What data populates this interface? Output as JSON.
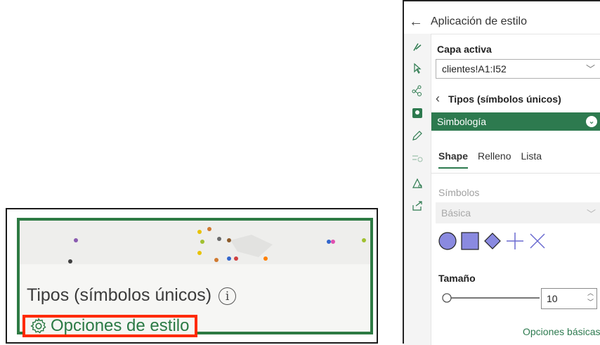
{
  "thumbnail": {
    "title": "Tipos (símbolos únicos)",
    "info_icon": "info-icon",
    "options_link": "Opciones de estilo",
    "options_icon": "gear-icon"
  },
  "panel": {
    "header_title": "Aplicación de estilo",
    "back_icon": "arrow-left-icon",
    "rail_icons": [
      "brush-icon",
      "cursor-icon",
      "network-icon",
      "layer-icon",
      "pencil-icon",
      "filter-icon",
      "map-pin-icon",
      "share-icon"
    ],
    "active_layer_label": "Capa activa",
    "active_layer_value": "clientes!A1:I52",
    "subsection_title": "Tipos (símbolos únicos)",
    "symbology_label": "Simbología",
    "tabs": [
      "Shape",
      "Relleno",
      "Lista"
    ],
    "active_tab": "Shape",
    "symbols_label": "Símbolos",
    "symbols_select_value": "Básica",
    "shape_options": [
      "circle",
      "square",
      "diamond",
      "plus",
      "cross"
    ],
    "size_label": "Tamaño",
    "size_value": "10",
    "basic_options_link": "Opciones básicas"
  },
  "colors": {
    "accent_green": "#2d7a4f",
    "highlight_red": "#ff2a00",
    "symbol_fill": "#8a8ae0"
  }
}
